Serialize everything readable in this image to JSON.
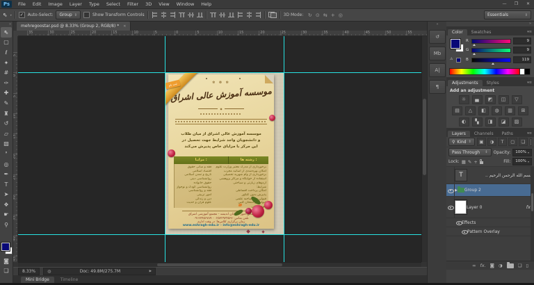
{
  "app": {
    "logo": "Ps",
    "menus": [
      "File",
      "Edit",
      "Image",
      "Layer",
      "Type",
      "Select",
      "Filter",
      "3D",
      "View",
      "Window",
      "Help"
    ],
    "window_controls": {
      "minimize": "—",
      "restore": "❐",
      "close": "✕"
    }
  },
  "options": {
    "tool_glyph": "⇖",
    "dropdown_arrow": "▾",
    "auto_select_label": "Auto-Select:",
    "auto_select_checked": "✓",
    "auto_select_target": "Group",
    "spin": "⇕",
    "show_transform_label": "Show Transform Controls",
    "mode_label": "3D Mode:",
    "mode_icons": [
      {
        "name": "3d-rotate-icon",
        "glyph": "↻"
      },
      {
        "name": "3d-roll-icon",
        "glyph": "⊙"
      },
      {
        "name": "3d-drag-icon",
        "glyph": "⇆"
      },
      {
        "name": "3d-slide-icon",
        "glyph": "+"
      },
      {
        "name": "3d-scale-icon",
        "glyph": "◎"
      }
    ],
    "workspace": "Essentials"
  },
  "tools": [
    {
      "name": "move-tool",
      "glyph": "⇖"
    },
    {
      "name": "marquee-tool",
      "glyph": "▢"
    },
    {
      "name": "lasso-tool",
      "glyph": "ℓ"
    },
    {
      "name": "quick-selection-tool",
      "glyph": "✦"
    },
    {
      "name": "crop-tool",
      "glyph": "#"
    },
    {
      "name": "eyedropper-tool",
      "glyph": "✑"
    },
    {
      "name": "healing-brush-tool",
      "glyph": "✚"
    },
    {
      "name": "brush-tool",
      "glyph": "✎"
    },
    {
      "name": "clone-stamp-tool",
      "glyph": "♜"
    },
    {
      "name": "history-brush-tool",
      "glyph": "↺"
    },
    {
      "name": "eraser-tool",
      "glyph": "▱"
    },
    {
      "name": "gradient-tool",
      "glyph": "▧"
    },
    {
      "name": "blur-tool",
      "glyph": "❜"
    },
    {
      "name": "dodge-tool",
      "glyph": "◎"
    },
    {
      "name": "pen-tool",
      "glyph": "✒"
    },
    {
      "name": "type-tool",
      "glyph": "T"
    },
    {
      "name": "path-selection-tool",
      "glyph": "➤"
    },
    {
      "name": "shape-tool",
      "glyph": "❖"
    },
    {
      "name": "hand-tool",
      "glyph": "☛"
    },
    {
      "name": "zoom-tool",
      "glyph": "⚲"
    }
  ],
  "document": {
    "tab_title": "mehregoostar.psd @ 8.33% (Group 2, RGB/8) *",
    "tab_close": "✕",
    "h_ruler": [
      "35",
      "30",
      "25",
      "20",
      "15",
      "10",
      "5",
      "0",
      "5",
      "10",
      "15",
      "20",
      "25",
      "30",
      "35",
      "40",
      "45",
      "50",
      "55",
      "60",
      "65"
    ],
    "v_ruler": [
      "5",
      "0",
      "5",
      "10",
      "15",
      "20",
      "25",
      "30",
      "35",
      "40",
      "45"
    ],
    "status_zoom": "8.33%",
    "status_doc": "Doc: 49.8M/275.7M",
    "status_arrow": "▶",
    "bottom_tabs": [
      "Mini Bridge",
      "Timeline"
    ]
  },
  "poster": {
    "flag": "ثبت نام",
    "ornament": "✻ ❁ ✻",
    "title": "موسسه آموزش عالی اشراق",
    "intro_lines": [
      "موسسه آموزش عالی اشراق از میان طلاب",
      "و دانشجویان واجد شرایط جهت تحصیل در",
      "این مرکز با مزایای خاص پذیرش می‌کند"
    ],
    "table": {
      "fields_header": "رشته ها :",
      "benefits_header": "مزایـا :",
      "fields": [
        "فقه و مبانی حقوق",
        "اقتصاد اسلامی",
        "تاریخ و تمدن اسلامی",
        "روانشناسی دینی",
        "حقوق خانواده",
        "روانشناسی کودک و نوجوان",
        "فقه و روانشناسی",
        "امور تربیتی",
        "دین و زندگی",
        "علوم قرآن و حدیث"
      ],
      "benefits": [
        "برخورداری از مدرک معتبر وزارت علوم",
        "امکان بهره‌مندی از اساتید مجرب",
        "برخورداری از وام شهریه تحصیلی",
        "استفاده از خوابگاه و مراکز پژوهشی",
        "اردوهای زیارتی و سیاحتی",
        "شرایط:",
        "امکان پرداخت اقساطی",
        "پذیرش بدون کنکور",
        "قبولی در مصاحبه علمی",
        "قبولی در امتحان کتبی",
        "تعهد اخلاقی"
      ]
    },
    "address_lines": [
      "سالن امور - خیابان اندیشه - مجتمع آموزشی اشراق",
      "تلفن تماس: ۰۲۵۳۲۹۳۴۵۶۷ - ۰۹۱۲۳۴۵۶۷۸۹",
      "زمان برگزاری کلاس‌ها: در وقت اداری"
    ],
    "website": "www.eshragh-edu.ir  -  info@eshragh-edu.ir"
  },
  "dock_strip": [
    {
      "name": "history-icon",
      "glyph": "↺"
    },
    {
      "name": "mini-bridge-icon",
      "glyph": "Mb"
    },
    {
      "name": "character-icon",
      "glyph": "A|"
    },
    {
      "name": "paragraph-icon",
      "glyph": "¶"
    }
  ],
  "color_panel": {
    "tabs": [
      "Color",
      "Swatches"
    ],
    "channels": [
      {
        "label": "R",
        "value": "9"
      },
      {
        "label": "G",
        "value": "9"
      },
      {
        "label": "B",
        "value": "119"
      }
    ],
    "warning": "⚠",
    "foreground": "#090977",
    "background": "#ffffff"
  },
  "adjustments_panel": {
    "tabs": [
      "Adjustments",
      "Styles"
    ],
    "heading": "Add an adjustment",
    "row1": [
      "☼",
      "▄",
      "◩",
      "◫",
      "▽"
    ],
    "row2": [
      "▤",
      "△",
      "◧",
      "◍",
      "▥",
      "⊞"
    ],
    "row3": [
      "◐",
      "▚",
      "◨",
      "◪",
      "▨"
    ]
  },
  "layers_panel": {
    "tabs": [
      "Layers",
      "Channels",
      "Paths"
    ],
    "search_glyph": "⚲",
    "kind": "Kind",
    "type_icons": [
      "▣",
      "◑",
      "T",
      "▢",
      "❏"
    ],
    "blend_mode": "Pass Through",
    "opacity_label": "Opacity:",
    "opacity": "100%",
    "lock_label": "Lock:",
    "fill_label": "Fill:",
    "fill": "100%",
    "layers": {
      "type_layer": "بسم الله الرحمن الرحيم ..",
      "group": "Group 2",
      "layer0": "Layer 0",
      "effects": "Effects",
      "pattern_overlay": "Pattern Overlay"
    },
    "fx_label": "fx.",
    "footer_icons": {
      "link": "∞",
      "fx": "fx.",
      "mask": "◙",
      "adjustment": "◑",
      "new_layer": "❏",
      "trash": "▯"
    }
  }
}
